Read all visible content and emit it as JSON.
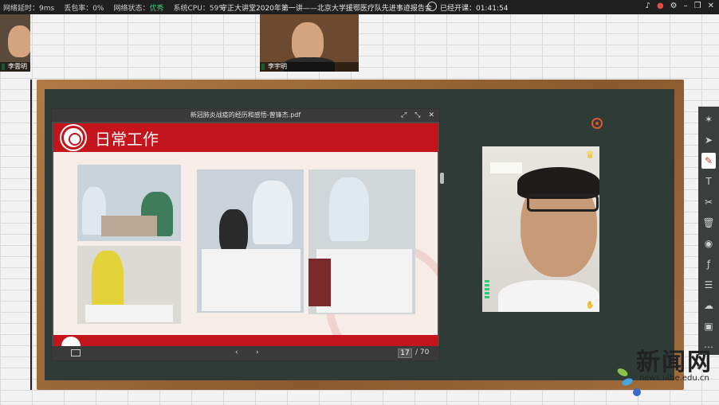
{
  "topbar": {
    "latency": "网络延时：9ms",
    "packet_loss": "丢包率：0%",
    "net_status_label": "网络状态：",
    "net_status_value": "优秀",
    "cpu": "系统CPU：59%",
    "title": "守正大讲堂2020年第一讲——北京大学援鄂医疗队先进事迹报告会",
    "class_time_label": "已经开课：",
    "class_time_value": "01:41:54",
    "icons": [
      "bell-icon",
      "record-icon",
      "settings-icon",
      "minimize-icon",
      "restore-icon",
      "close-icon"
    ]
  },
  "participants": [
    {
      "name": "李雲明"
    },
    {
      "name": "李宇明"
    }
  ],
  "pdf": {
    "filename": "新冠肺炎战疫的经历和感悟-曾锋杰.pdf",
    "slide_title": "日常工作",
    "page_current": "17",
    "page_total": "/ 70",
    "controls": [
      "restore-icon",
      "maximize-icon",
      "close-icon"
    ]
  },
  "toolbar": {
    "tools": [
      "laser-pointer-icon",
      "select-icon",
      "pen-icon",
      "text-icon",
      "scissors-icon",
      "trash-icon",
      "record-icon",
      "formula-icon",
      "chat-icon",
      "cloud-icon",
      "toolbox-icon",
      "more-icon"
    ],
    "active_index": 2
  },
  "watermark": {
    "cn": "新闻网",
    "url": "news.uibe.edu.cn"
  },
  "colors": {
    "slide_red": "#c3151b",
    "board_green": "#2f3b36",
    "frame_wood": "#8a5a2e",
    "status_good": "#2ecc71"
  }
}
